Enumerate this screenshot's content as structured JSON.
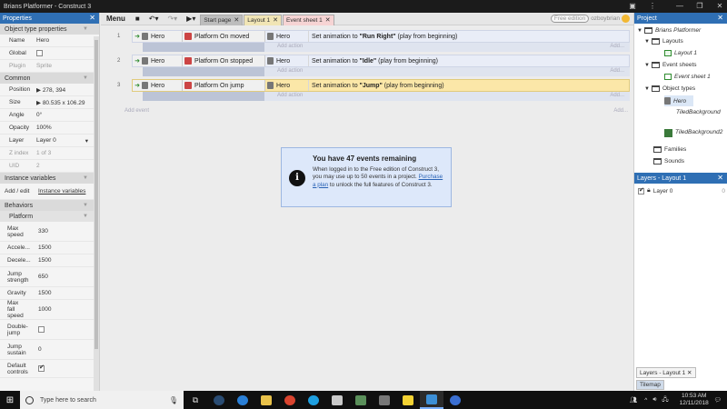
{
  "window": {
    "title": "Brians Platformer - Construct 3",
    "minimize": "—",
    "maximize": "❐",
    "close": "✕",
    "menu_dots": "⋮"
  },
  "properties": {
    "header": "Properties",
    "sections": {
      "object_type": "Object type properties",
      "common": "Common",
      "instance_vars": "Instance variables",
      "behaviors": "Behaviors",
      "platform": "Platform"
    },
    "name": {
      "k": "Name",
      "v": "Hero"
    },
    "global": {
      "k": "Global"
    },
    "plugin": {
      "k": "Plugin",
      "v": "Sprite"
    },
    "position": {
      "k": "Position",
      "v": "278, 394"
    },
    "size": {
      "k": "Size",
      "v": "80.535 x 106.29"
    },
    "angle": {
      "k": "Angle",
      "v": "0°"
    },
    "opacity": {
      "k": "Opacity",
      "v": "100%"
    },
    "layer": {
      "k": "Layer",
      "v": "Layer 0"
    },
    "zindex": {
      "k": "Z index",
      "v": "1 of 3"
    },
    "uid": {
      "k": "UID",
      "v": "2"
    },
    "addedit": {
      "k": "Add / edit",
      "v": "Instance variables"
    },
    "max_speed": {
      "k": "Max speed",
      "v": "330"
    },
    "acceleration": {
      "k": "Accele...",
      "v": "1500"
    },
    "deceleration": {
      "k": "Decele...",
      "v": "1500"
    },
    "jump_strength": {
      "k": "Jump strength",
      "v": "650"
    },
    "gravity": {
      "k": "Gravity",
      "v": "1500"
    },
    "max_fall": {
      "k": "Max fall speed",
      "v": "1000"
    },
    "double_jump": {
      "k": "Double-jump"
    },
    "jump_sustain": {
      "k": "Jump sustain",
      "v": "0"
    },
    "default_controls": {
      "k": "Default controls"
    }
  },
  "toolbar": {
    "menu": "Menu",
    "tabs": [
      {
        "label": "Start page"
      },
      {
        "label": "Layout 1"
      },
      {
        "label": "Event sheet 1"
      }
    ],
    "free_badge": "Free edition",
    "user": "ozboybrian",
    "tab_close": "✕"
  },
  "events": [
    {
      "num": "1",
      "obj": "Hero",
      "trigger": "Platform On moved",
      "action_obj": "Hero",
      "action_pre": "Set animation to ",
      "action_val": "\"Run Right\"",
      "action_post": " (play from beginning)"
    },
    {
      "num": "2",
      "obj": "Hero",
      "trigger": "Platform On stopped",
      "action_obj": "Hero",
      "action_pre": "Set animation to ",
      "action_val": "\"Idle\"",
      "action_post": " (play from beginning)"
    },
    {
      "num": "3",
      "obj": "Hero",
      "trigger": "Platform On jump",
      "action_obj": "Hero",
      "action_pre": "Set animation to ",
      "action_val": "\"Jump\"",
      "action_post": " (play from beginning)"
    }
  ],
  "sheet": {
    "add_action": "Add action",
    "add_ellipsis": "Add...",
    "add_event": "Add event"
  },
  "info": {
    "title": "You have 47 events remaining",
    "text1": "When logged in to the Free edition of Construct 3, you may use up to 50 events in a project. ",
    "link": "Purchase a plan",
    "text2": " to unlock the full features of Construct 3."
  },
  "project": {
    "header": "Project",
    "root": "Brians Platformer",
    "layouts": "Layouts",
    "layout1": "Layout 1",
    "event_sheets": "Event sheets",
    "event_sheet1": "Event sheet 1",
    "object_types": "Object types",
    "hero": "Hero",
    "tiled1": "TiledBackground",
    "tiled2": "TiledBackground2",
    "families": "Families",
    "sounds": "Sounds"
  },
  "layers": {
    "header": "Layers - Layout 1",
    "layer0": "Layer 0",
    "count": "0"
  },
  "bottom_tabs": {
    "layers": "Layers - Layout 1",
    "tilemap": "Tilemap"
  },
  "taskbar": {
    "search": "Type here to search",
    "time": "10:53 AM",
    "date": "12/11/2018"
  }
}
